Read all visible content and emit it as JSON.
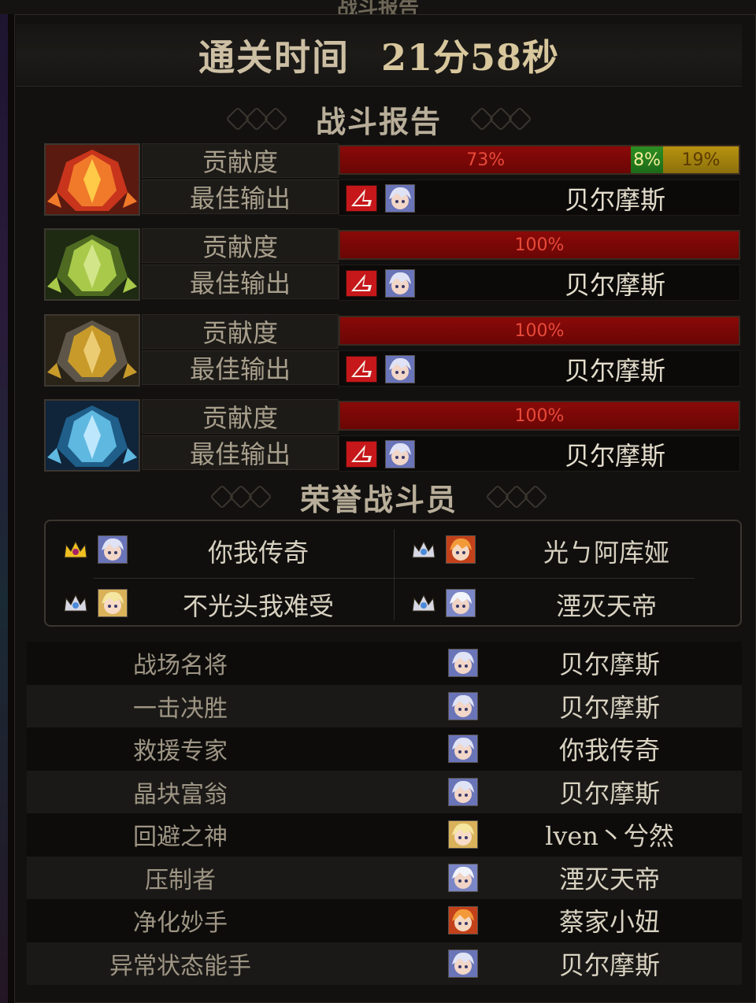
{
  "window": {
    "title": "战斗报告"
  },
  "clear_time": {
    "label": "通关时间",
    "value": "21分58秒"
  },
  "battle_report": {
    "title": "战斗报告",
    "contribution_label": "贡献度",
    "best_output_label": "最佳输出",
    "bosses": [
      {
        "portrait_icon": "red-armor-boss-icon",
        "segments": [
          {
            "pct": 73,
            "label": "73%",
            "color": "#8a0a08"
          },
          {
            "pct": 8,
            "label": "8%",
            "color": "#2c8d22"
          },
          {
            "pct": 19,
            "label": "19%",
            "color": "#b79310"
          }
        ],
        "best_output_job_icon": "red-job-icon",
        "best_output_name": "贝尔摩斯"
      },
      {
        "portrait_icon": "green-armor-boss-icon",
        "segments": [
          {
            "pct": 100,
            "label": "100%",
            "color": "#8a0a08"
          }
        ],
        "best_output_job_icon": "red-job-icon",
        "best_output_name": "贝尔摩斯"
      },
      {
        "portrait_icon": "gold-armor-boss-icon",
        "segments": [
          {
            "pct": 100,
            "label": "100%",
            "color": "#8a0a08"
          }
        ],
        "best_output_job_icon": "red-job-icon",
        "best_output_name": "贝尔摩斯"
      },
      {
        "portrait_icon": "blue-armor-boss-icon",
        "segments": [
          {
            "pct": 100,
            "label": "100%",
            "color": "#8a0a08"
          }
        ],
        "best_output_job_icon": "red-job-icon",
        "best_output_name": "贝尔摩斯"
      }
    ]
  },
  "honor_fighters": {
    "title": "荣誉战斗员",
    "members": [
      {
        "name": "你我传奇",
        "crown_icon": "gold-crown-icon",
        "avatar": "silver-hair-avatar"
      },
      {
        "name": "光ㄅ阿库娅",
        "crown_icon": "silver-crown-icon",
        "avatar": "orange-hair-avatar"
      },
      {
        "name": "不光头我难受",
        "crown_icon": "silver-crown-icon",
        "avatar": "blonde-avatar"
      },
      {
        "name": "湮灭天帝",
        "crown_icon": "silver-crown-icon",
        "avatar": "white-hair-avatar"
      }
    ]
  },
  "awards": [
    {
      "title": "战场名将",
      "name": "贝尔摩斯"
    },
    {
      "title": "一击决胜",
      "name": "贝尔摩斯"
    },
    {
      "title": "救援专家",
      "name": "你我传奇"
    },
    {
      "title": "晶块富翁",
      "name": "贝尔摩斯"
    },
    {
      "title": "回避之神",
      "name": "lven丶兮然"
    },
    {
      "title": "压制者",
      "name": "湮灭天帝"
    },
    {
      "title": "净化妙手",
      "name": "蔡家小妞"
    },
    {
      "title": "异常状态能手",
      "name": "贝尔摩斯"
    }
  ]
}
